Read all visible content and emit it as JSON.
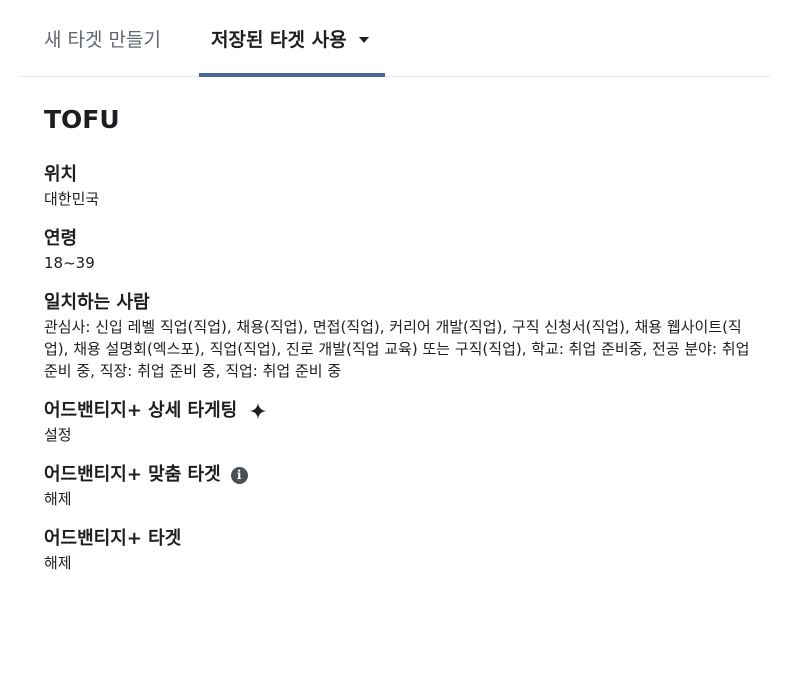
{
  "tabs": {
    "new_label": "새 타겟 만들기",
    "saved_label": "저장된 타겟 사용"
  },
  "audience": {
    "name": "TOFU"
  },
  "sections": {
    "location": {
      "label": "위치",
      "value": "대한민국"
    },
    "age": {
      "label": "연령",
      "value": "18~39"
    },
    "matching": {
      "label": "일치하는 사람",
      "value": "관심사: 신입 레벨 직업(직업), 채용(직업), 면접(직업), 커리어 개발(직업), 구직 신청서(직업), 채용 웹사이트(직업), 채용 설명회(엑스포), 직업(직업), 진로 개발(직업 교육) 또는 구직(직업), 학교: 취업 준비중, 전공 분야: 취업 준비 중, 직장: 취업 준비 중, 직업: 취업 준비 중"
    },
    "advantage_detailed": {
      "label": "어드밴티지+ 상세 타게팅",
      "value": "설정",
      "icon": "sparkle-icon"
    },
    "advantage_custom": {
      "label": "어드밴티지+ 맞춤 타겟",
      "value": "해제",
      "icon": "info-icon"
    },
    "advantage_audience": {
      "label": "어드밴티지+ 타겟",
      "value": "해제"
    }
  }
}
